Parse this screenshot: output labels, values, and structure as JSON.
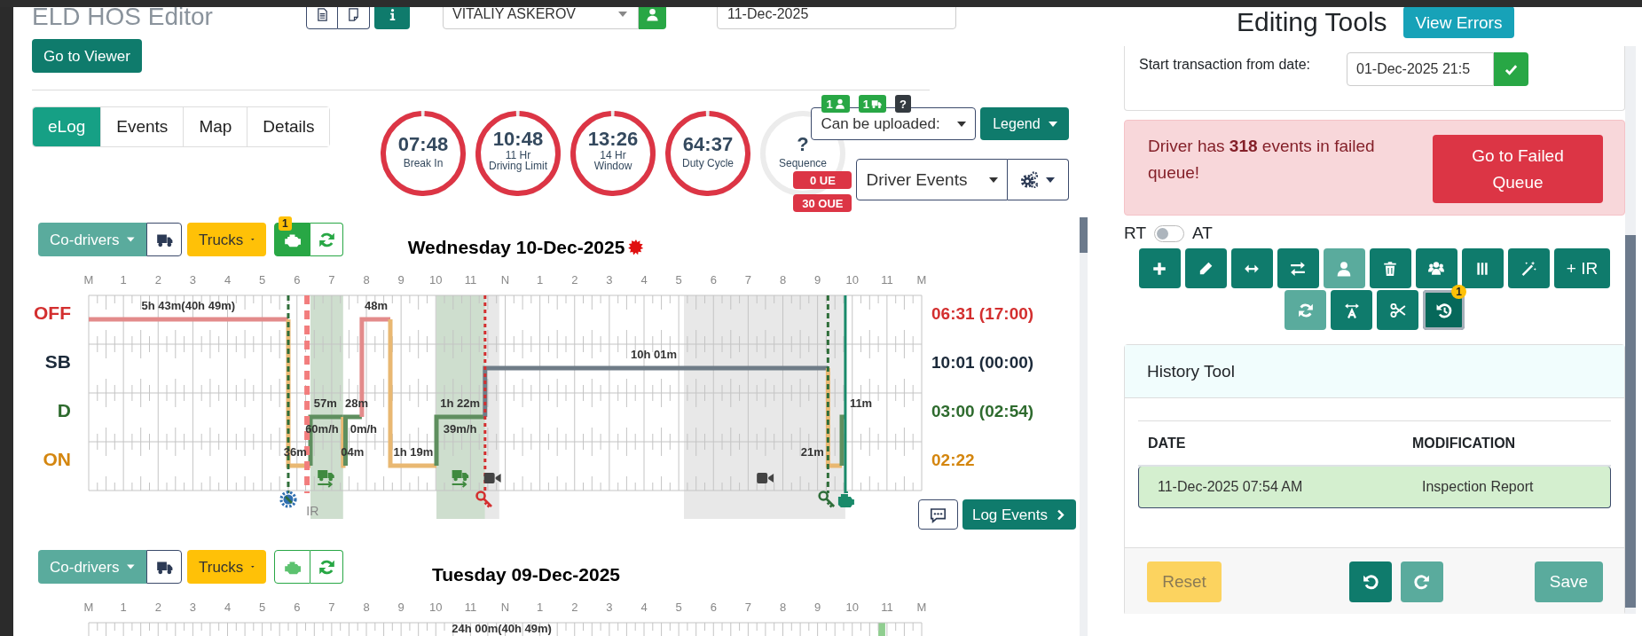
{
  "header": {
    "title": "ELD HOS Editor",
    "driver": "VITALIY ASKEROV",
    "date": "11-Dec-2025",
    "viewer_button": "Go to Viewer"
  },
  "tabs": [
    {
      "label": "eLog",
      "selected": true
    },
    {
      "label": "Events",
      "selected": false
    },
    {
      "label": "Map",
      "selected": false
    },
    {
      "label": "Details",
      "selected": false
    }
  ],
  "gauges": [
    {
      "value": "07:48",
      "lines": [
        "Break In"
      ],
      "level": 1
    },
    {
      "value": "10:48",
      "lines": [
        "11 Hr",
        "Driving Limit"
      ],
      "level": 1
    },
    {
      "value": "13:26",
      "lines": [
        "14 Hr",
        "Window"
      ],
      "level": 1
    },
    {
      "value": "64:37",
      "lines": [
        "Duty Cycle"
      ],
      "level": 1
    },
    {
      "value": "?",
      "lines": [
        "Sequence"
      ],
      "level": 0
    }
  ],
  "counters": [
    {
      "text": "1",
      "kind": "person"
    },
    {
      "text": "1",
      "kind": "truck"
    },
    {
      "text": "?",
      "kind": "help"
    }
  ],
  "upload_select": "Can be uploaded:",
  "legend_button": "Legend",
  "ue_badges": [
    "0 UE",
    "30 OUE"
  ],
  "events_select": "Driver Events",
  "days": [
    {
      "title": "Wednesday 10-Dec-2025",
      "flagged": true,
      "codrivers": "Co-drivers",
      "trucks": "Trucks",
      "engine_active": true,
      "engine_badge": "1",
      "log_events_button": "Log Events",
      "hours": [
        "M",
        "1",
        "2",
        "3",
        "4",
        "5",
        "6",
        "7",
        "8",
        "9",
        "10",
        "11",
        "N",
        "1",
        "2",
        "3",
        "4",
        "5",
        "6",
        "7",
        "8",
        "9",
        "10",
        "11",
        "M"
      ],
      "rows": [
        {
          "label": "OFF",
          "total": "06:31 (17:00)",
          "color": "#d32f2f"
        },
        {
          "label": "SB",
          "total": "10:01 (00:00)",
          "color": "#1c2a3a"
        },
        {
          "label": "D",
          "total": "03:00 (02:54)",
          "color": "#2e6b2e"
        },
        {
          "label": "ON",
          "total": "02:22",
          "color": "#d4860f"
        }
      ],
      "durations": [
        "5h 43m(40h 49m)",
        "48m",
        "10h 01m",
        "57m",
        "28m",
        "1h 22m",
        "60m/h",
        "0m/h",
        "39m/h",
        "11m",
        "36m",
        "04m",
        "1h 19m",
        "21m"
      ],
      "note": "IR"
    },
    {
      "title": "Tuesday 09-Dec-2025",
      "flagged": false,
      "codrivers": "Co-drivers",
      "trucks": "Trucks",
      "engine_active": false,
      "hours": [
        "M",
        "1",
        "2",
        "3",
        "4",
        "5",
        "6",
        "7",
        "8",
        "9",
        "10",
        "11",
        "N",
        "1",
        "2",
        "3",
        "4",
        "5",
        "6",
        "7",
        "8",
        "9",
        "10",
        "11",
        "M"
      ],
      "durations": [
        "24h 00m(40h 49m)"
      ]
    }
  ],
  "editing": {
    "title": "Editing Tools",
    "errors_button": "View Errors",
    "transaction_label": "Start transaction from date:",
    "transaction_value": "01-Dec-2025 21:5"
  },
  "alert": {
    "text": "Driver has **318** events in failed queue!",
    "button": "Go to Failed Queue"
  },
  "mode_toggle": {
    "left": "RT",
    "right": "AT",
    "on": false
  },
  "tool_rows": [
    {
      "items": [
        {
          "kind": "plus",
          "disabled": false,
          "selected": false
        },
        {
          "kind": "pencil",
          "disabled": false,
          "selected": false
        },
        {
          "kind": "arrows",
          "disabled": false,
          "selected": false
        },
        {
          "kind": "swap",
          "disabled": false,
          "selected": false
        },
        {
          "kind": "user",
          "disabled": true,
          "selected": false
        },
        {
          "kind": "trash",
          "disabled": false,
          "selected": false
        },
        {
          "kind": "users",
          "disabled": false,
          "selected": false
        },
        {
          "kind": "columns",
          "disabled": false,
          "selected": false
        },
        {
          "kind": "wand",
          "disabled": false,
          "selected": false
        },
        {
          "kind": "text",
          "label": "+ IR",
          "disabled": false,
          "selected": false
        }
      ]
    },
    {
      "items": [
        {
          "kind": "refresh",
          "disabled": true,
          "selected": false
        },
        {
          "kind": "textwidth",
          "disabled": false,
          "selected": false
        },
        {
          "kind": "scissors",
          "disabled": false,
          "selected": false
        },
        {
          "kind": "history",
          "badge": "1",
          "disabled": false,
          "selected": true
        }
      ]
    }
  ],
  "history": {
    "title": "History Tool",
    "columns": [
      "DATE",
      "MODIFICATION"
    ],
    "rows": [
      {
        "date": "11-Dec-2025 07:54 AM",
        "modification": "Inspection Report",
        "selected": true
      }
    ],
    "reset": {
      "label": "Reset",
      "disabled": true
    },
    "undo": {
      "disabled": false
    },
    "redo": {
      "disabled": true
    },
    "save": {
      "label": "Save",
      "disabled": true
    }
  }
}
